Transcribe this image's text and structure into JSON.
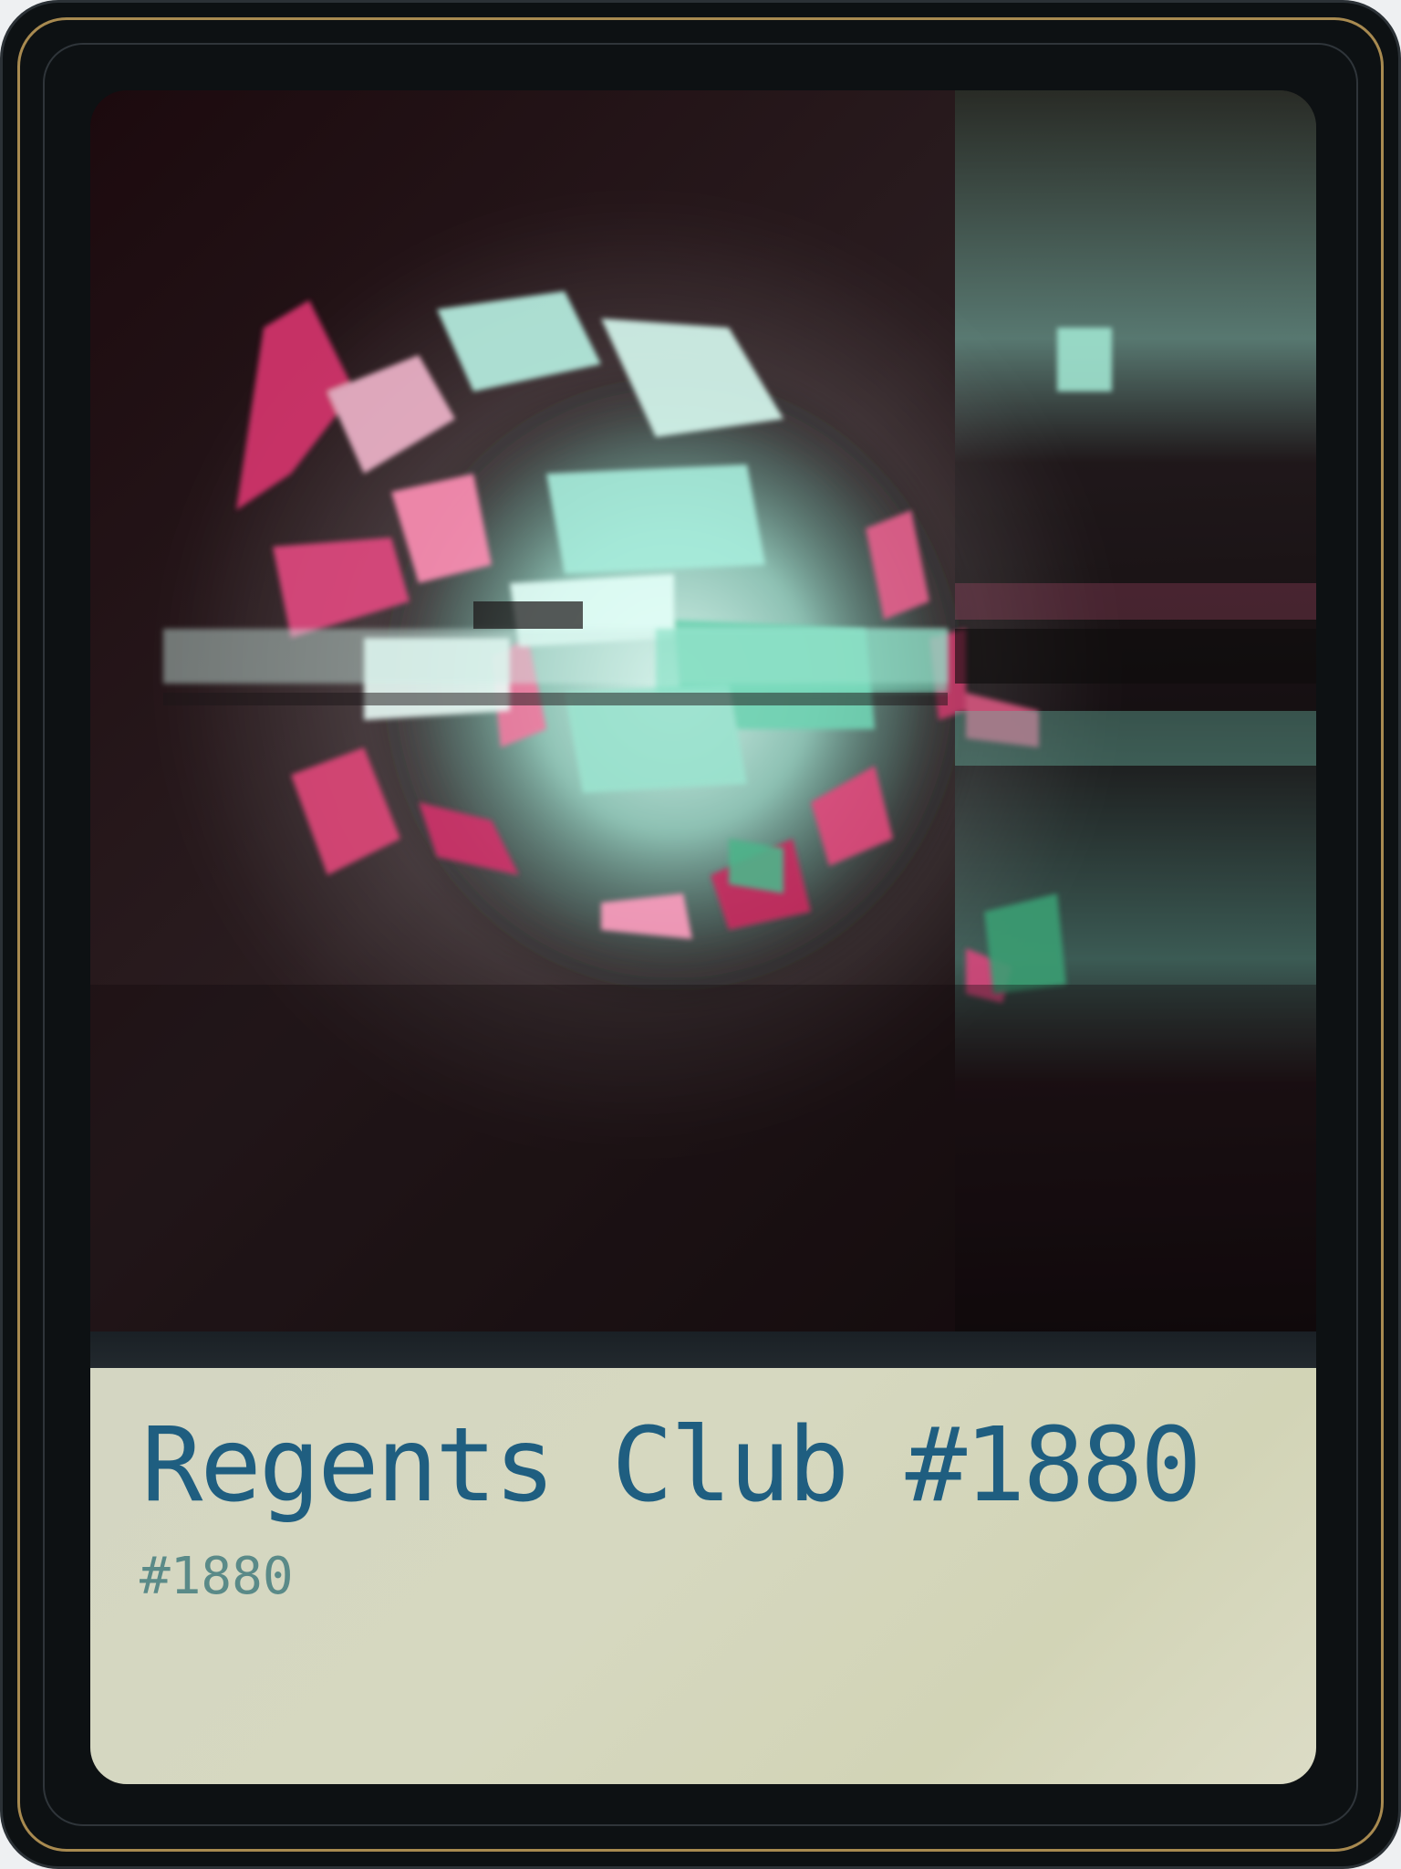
{
  "card": {
    "title": "Regents Club #1880",
    "token_id": "#1880"
  },
  "colors": {
    "frame": "#0d1113",
    "gold_border": "#a88a50",
    "panel": "#d4d6c2",
    "title": "#1f5e80",
    "subtitle": "#5a8a88",
    "art_pink": "#e0407a",
    "art_mint": "#8fe6cf",
    "art_green": "#3fae7d"
  }
}
